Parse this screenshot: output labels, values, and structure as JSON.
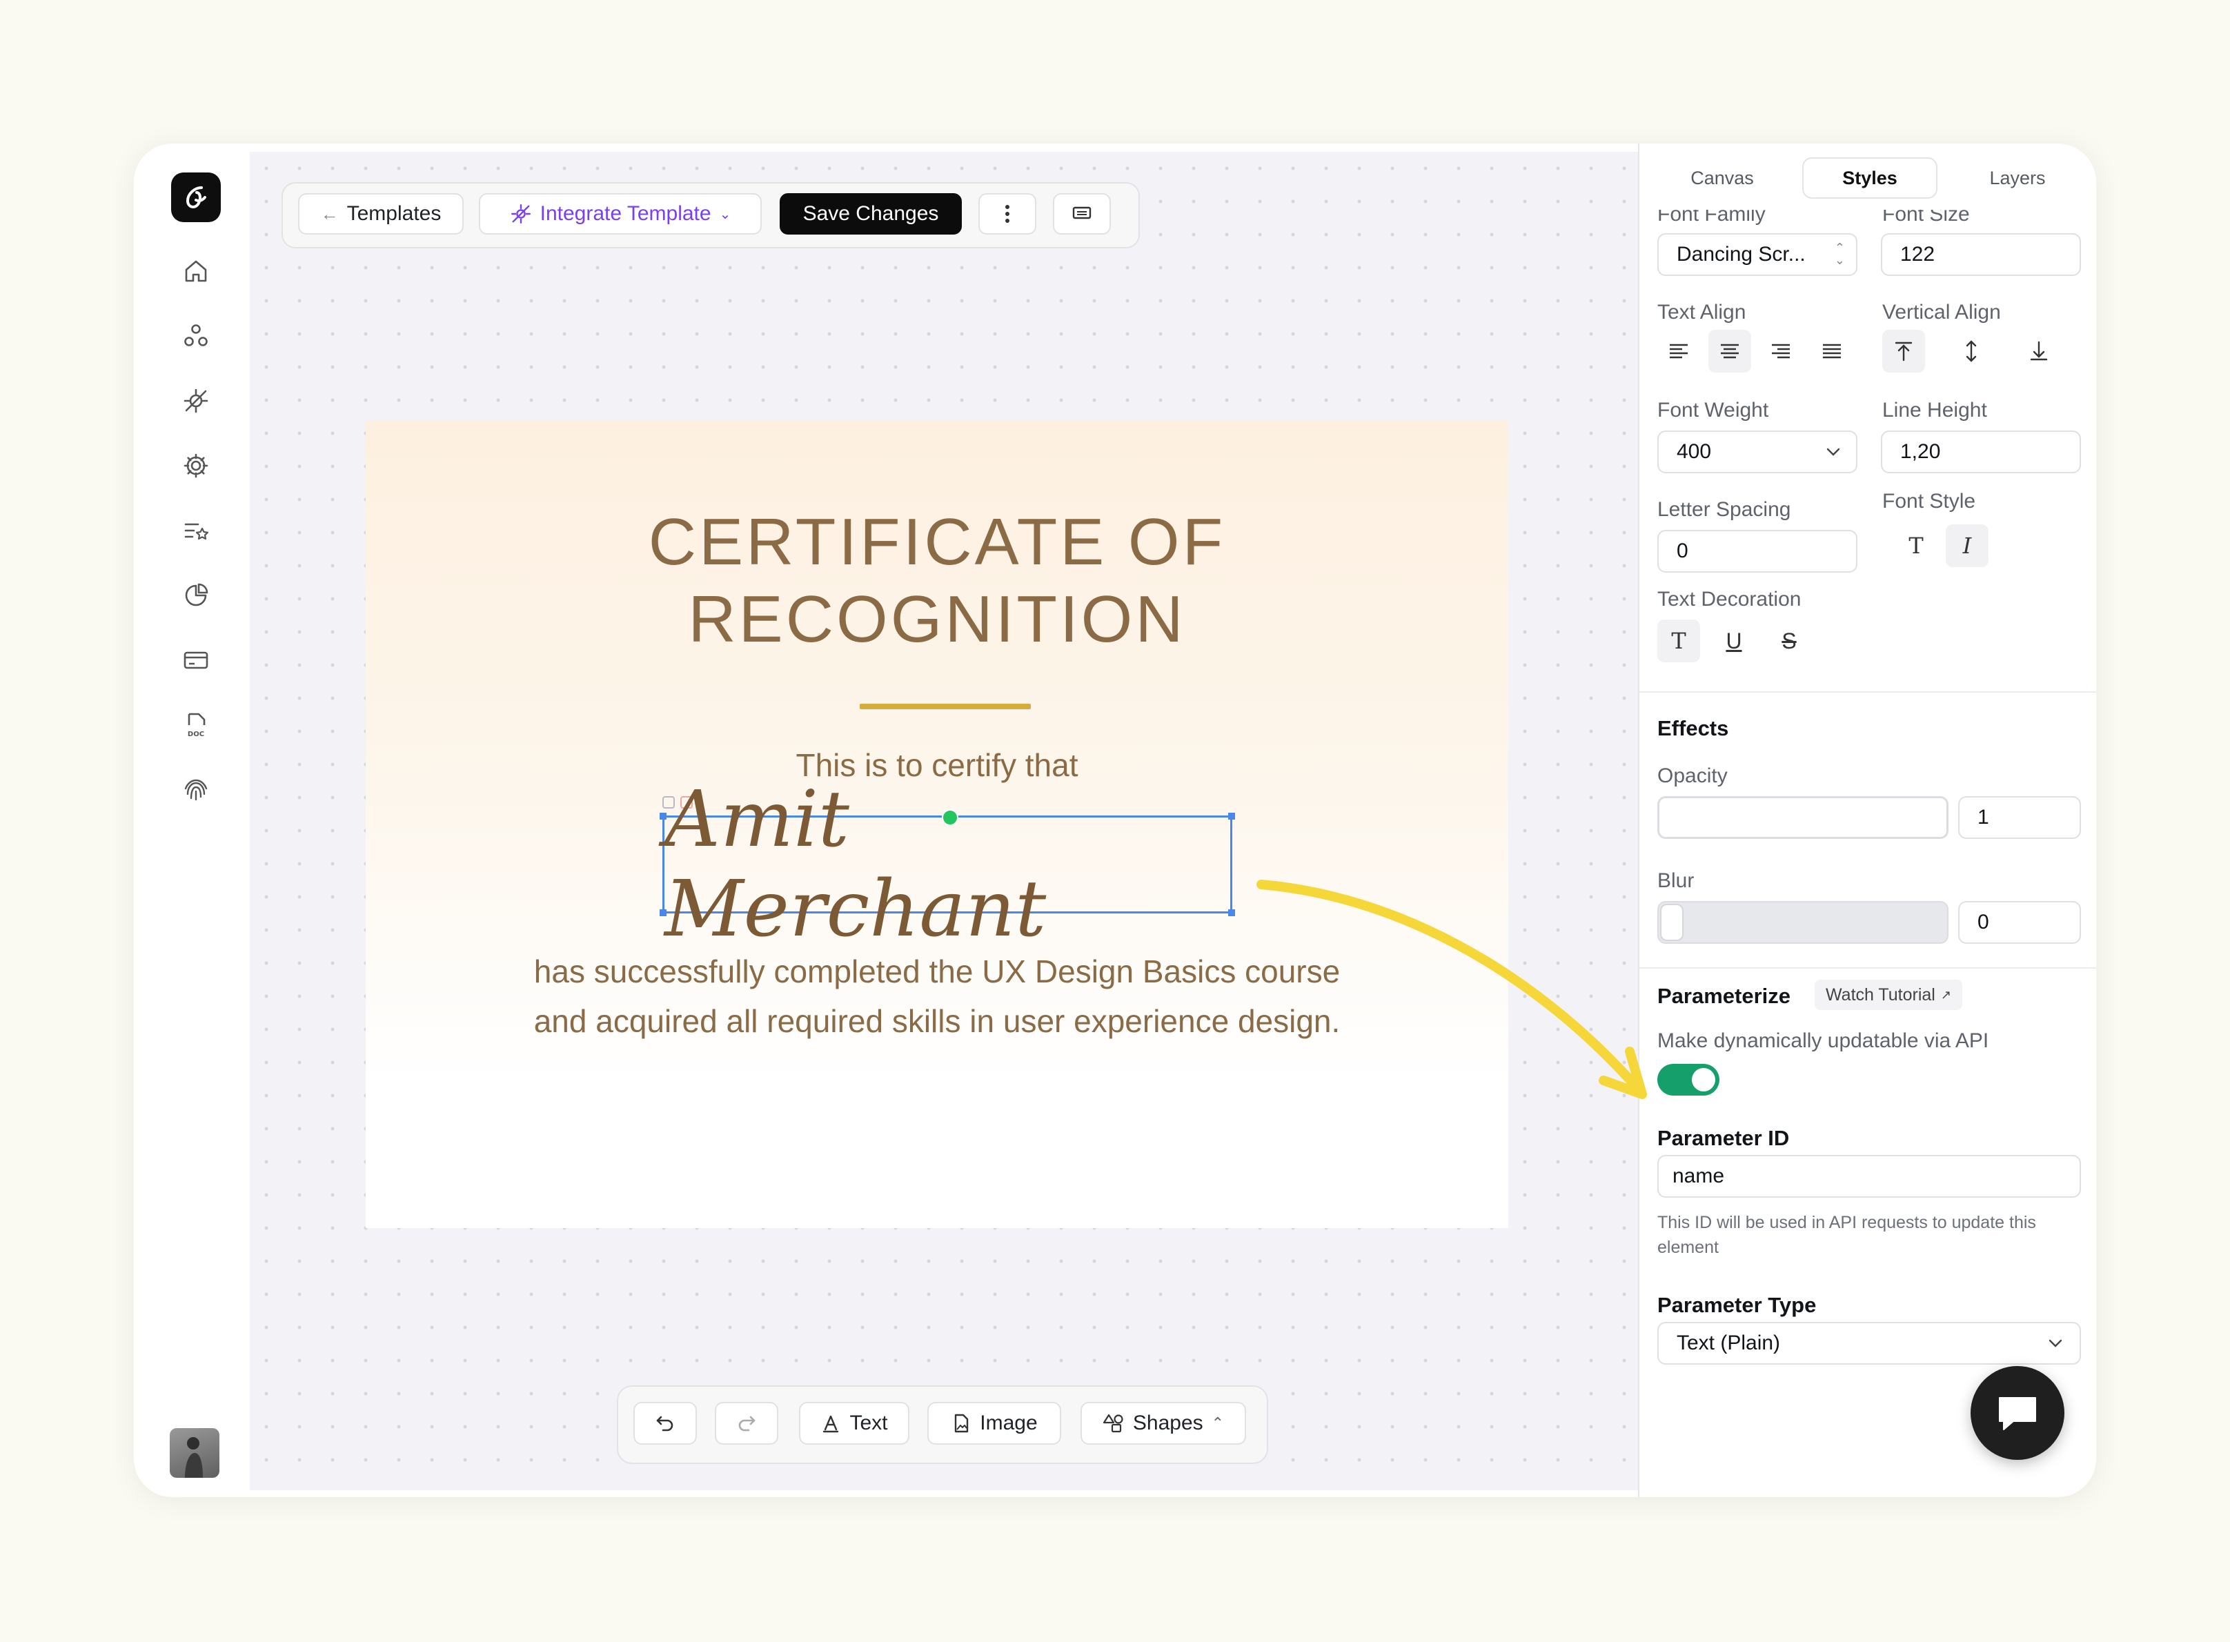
{
  "toolbar": {
    "templates_label": "Templates",
    "integrate_label": "Integrate Template",
    "save_label": "Save Changes"
  },
  "certificate": {
    "title_line1": "CERTIFICATE OF",
    "title_line2": "RECOGNITION",
    "intro": "This is to certify that",
    "recipient": "Amit Merchant",
    "body_line1": "has successfully completed the UX Design Basics course",
    "body_line2": "and acquired all required skills in user experience design."
  },
  "bottom_toolbar": {
    "text_label": "Text",
    "image_label": "Image",
    "shapes_label": "Shapes"
  },
  "panel": {
    "tabs": [
      {
        "label": "Canvas",
        "active": false
      },
      {
        "label": "Styles",
        "active": true
      },
      {
        "label": "Layers",
        "active": false
      }
    ],
    "font_family_label": "Font Family",
    "font_family_value": "Dancing Scr...",
    "font_size_label": "Font Size",
    "font_size_value": "122",
    "text_align_label": "Text Align",
    "vertical_align_label": "Vertical Align",
    "font_weight_label": "Font Weight",
    "font_weight_value": "400",
    "line_height_label": "Line Height",
    "line_height_value": "1,20",
    "letter_spacing_label": "Letter Spacing",
    "letter_spacing_value": "0",
    "font_style_label": "Font Style",
    "text_decoration_label": "Text Decoration",
    "effects_heading": "Effects",
    "opacity_label": "Opacity",
    "opacity_value": "1",
    "blur_label": "Blur",
    "blur_value": "0",
    "parameterize_heading": "Parameterize",
    "watch_tutorial_label": "Watch Tutorial",
    "dynamic_label": "Make dynamically updatable via API",
    "dynamic_enabled": true,
    "parameter_id_heading": "Parameter ID",
    "parameter_id_value": "name",
    "parameter_id_help": "This ID will be used in API requests to update this element",
    "parameter_type_heading": "Parameter Type",
    "parameter_type_value": "Text (Plain)"
  },
  "colors": {
    "accent_toggle": "#15a06b",
    "arrow": "#f5d73a",
    "certificate_text": "#8a6b45",
    "divider_gold": "#d6ac3a",
    "selection": "#4a87ea"
  }
}
